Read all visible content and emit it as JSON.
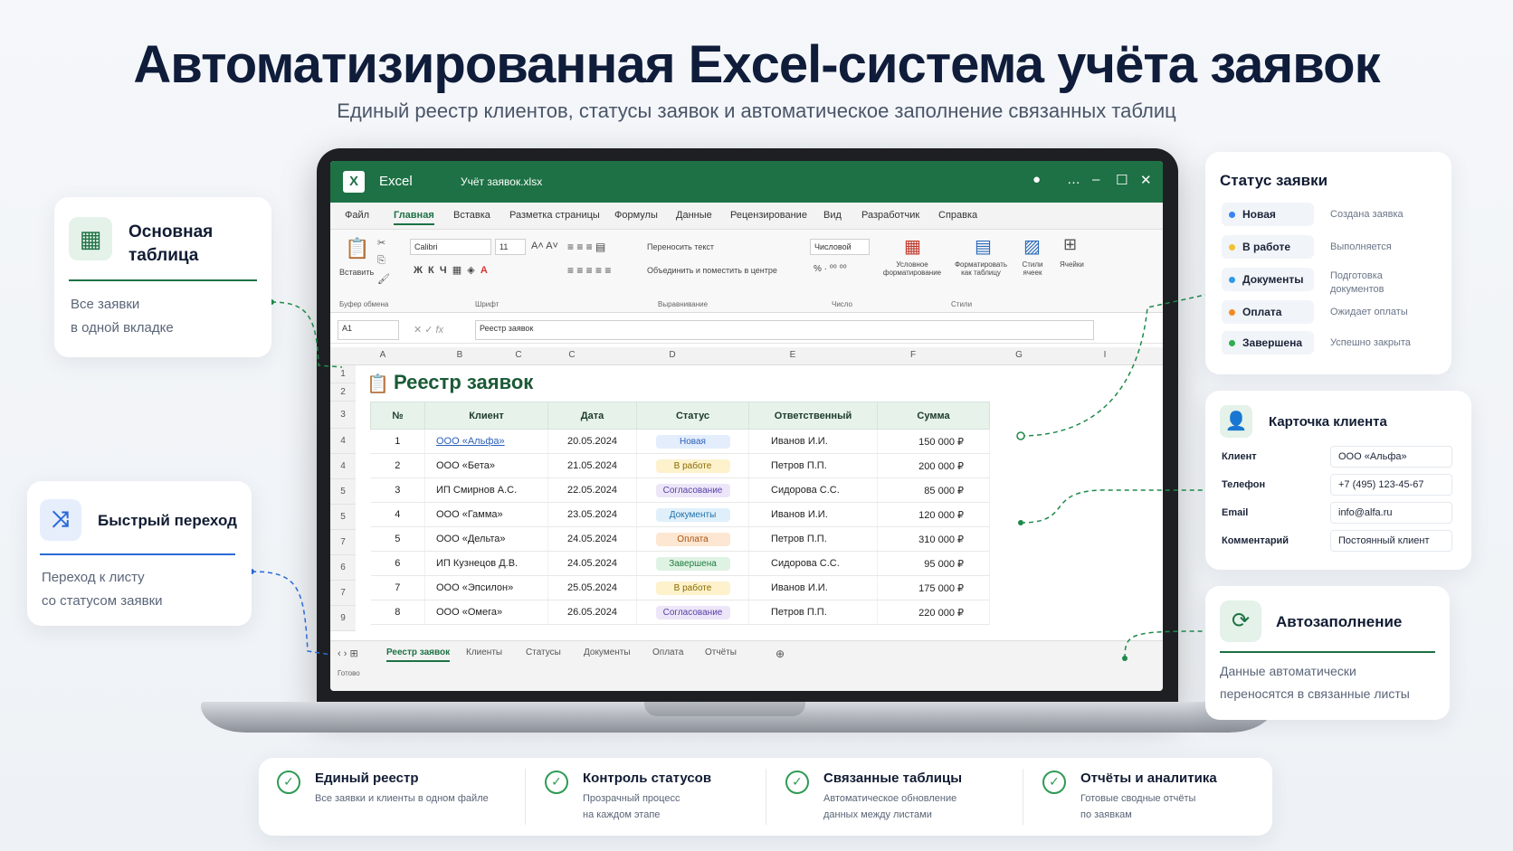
{
  "header": {
    "title": "Автоматизированная Excel-система учёта заявок",
    "subtitle": "Единый реестр клиентов, статусы заявок и автоматическое заполнение связанных таблиц"
  },
  "excel": {
    "app": "Excel",
    "file": "Учёт заявок.xlsx",
    "tabs": [
      "Файл",
      "Главная",
      "Вставка",
      "Разметка страницы",
      "Формулы",
      "Данные",
      "Рецензирование",
      "Вид",
      "Разработчик",
      "Справка"
    ],
    "ribbon": {
      "paste": "Вставить",
      "font": "Calibri",
      "size": "11",
      "wrap": "Переносить текст",
      "merge": "Объединить и поместить в центре",
      "number_format": "Числовой",
      "cond_format": "Условное форматирование",
      "format_table": "Форматировать как таблицу",
      "cell_styles": "Стили ячеек",
      "cells": "Ячейки",
      "groups": [
        "Буфер обмена",
        "Шрифт",
        "Выравнивание",
        "Число",
        "Стили"
      ]
    },
    "name_box": "A1",
    "formula": "Реестр заявок",
    "columns": [
      "A",
      "B",
      "C",
      "C",
      "D",
      "E",
      "F",
      "G",
      "I"
    ],
    "row_numbers": [
      "1",
      "2",
      "3",
      "4",
      "4",
      "5",
      "5",
      "7",
      "6",
      "7",
      "9"
    ],
    "sheet_title": "Реестр заявок",
    "table": {
      "headers": [
        "№",
        "Клиент",
        "Дата",
        "Статус",
        "Ответственный",
        "Сумма"
      ],
      "rows": [
        {
          "n": "1",
          "client": "ООО «Альфа»",
          "date": "20.05.2024",
          "status": "Новая",
          "owner": "Иванов И.И.",
          "sum": "150 000 ₽"
        },
        {
          "n": "2",
          "client": "ООО «Бета»",
          "date": "21.05.2024",
          "status": "В работе",
          "owner": "Петров П.П.",
          "sum": "200 000 ₽"
        },
        {
          "n": "3",
          "client": "ИП Смирнов А.С.",
          "date": "22.05.2024",
          "status": "Согласование",
          "owner": "Сидорова С.С.",
          "sum": "85 000 ₽"
        },
        {
          "n": "4",
          "client": "ООО «Гамма»",
          "date": "23.05.2024",
          "status": "Документы",
          "owner": "Иванов И.И.",
          "sum": "120 000 ₽"
        },
        {
          "n": "5",
          "client": "ООО «Дельта»",
          "date": "24.05.2024",
          "status": "Оплата",
          "owner": "Петров П.П.",
          "sum": "310 000 ₽"
        },
        {
          "n": "6",
          "client": "ИП Кузнецов Д.В.",
          "date": "24.05.2024",
          "status": "Завершена",
          "owner": "Сидорова С.С.",
          "sum": "95 000 ₽"
        },
        {
          "n": "7",
          "client": "ООО «Эпсилон»",
          "date": "25.05.2024",
          "status": "В работе",
          "owner": "Иванов И.И.",
          "sum": "175 000 ₽"
        },
        {
          "n": "8",
          "client": "ООО «Омега»",
          "date": "26.05.2024",
          "status": "Согласование",
          "owner": "Петров П.П.",
          "sum": "220 000 ₽"
        }
      ]
    },
    "sheets": [
      "Реестр заявок",
      "Клиенты",
      "Статусы",
      "Документы",
      "Оплата",
      "Отчёты"
    ],
    "status_bar": "Готово"
  },
  "cards": {
    "main": {
      "title_1": "Основная",
      "title_2": "таблица",
      "desc_1": "Все заявки",
      "desc_2": "в одной вкладке"
    },
    "nav": {
      "title": "Быстрый переход",
      "desc_1": "Переход к листу",
      "desc_2": "со статусом заявки"
    },
    "status": {
      "title": "Статус заявки",
      "items": [
        {
          "label": "Новая",
          "desc": "Создана заявка",
          "color": "#3b82f6"
        },
        {
          "label": "В работе",
          "desc": "Выполняется",
          "color": "#f2c230"
        },
        {
          "label": "Документы",
          "desc_1": "Подготовка",
          "desc_2": "документов",
          "color": "#2e9be6"
        },
        {
          "label": "Оплата",
          "desc": "Ожидает оплаты",
          "color": "#f08a24"
        },
        {
          "label": "Завершена",
          "desc": "Успешно закрыта",
          "color": "#2eae4f"
        }
      ]
    },
    "client": {
      "title": "Карточка клиента",
      "fields": [
        {
          "k": "Клиент",
          "v": "ООО «Альфа»"
        },
        {
          "k": "Телефон",
          "v": "+7 (495) 123-45-67"
        },
        {
          "k": "Email",
          "v": "info@alfa.ru"
        },
        {
          "k": "Комментарий",
          "v": "Постоянный клиент"
        }
      ]
    },
    "auto": {
      "title": "Автозаполнение",
      "desc_1": "Данные автоматически",
      "desc_2": "переносятся в связанные листы"
    }
  },
  "features": [
    {
      "title": "Единый реестр",
      "d1": "Все заявки и клиенты в одном файле",
      "d2": ""
    },
    {
      "title": "Контроль статусов",
      "d1": "Прозрачный процесс",
      "d2": "на каждом этапе"
    },
    {
      "title": "Связанные таблицы",
      "d1": "Автоматическое обновление",
      "d2": "данных между листами"
    },
    {
      "title": "Отчёты и аналитика",
      "d1": "Готовые сводные отчёты",
      "d2": "по заявкам"
    }
  ],
  "colors": {
    "accent": "#1e7145",
    "check": "#2e9b54"
  }
}
